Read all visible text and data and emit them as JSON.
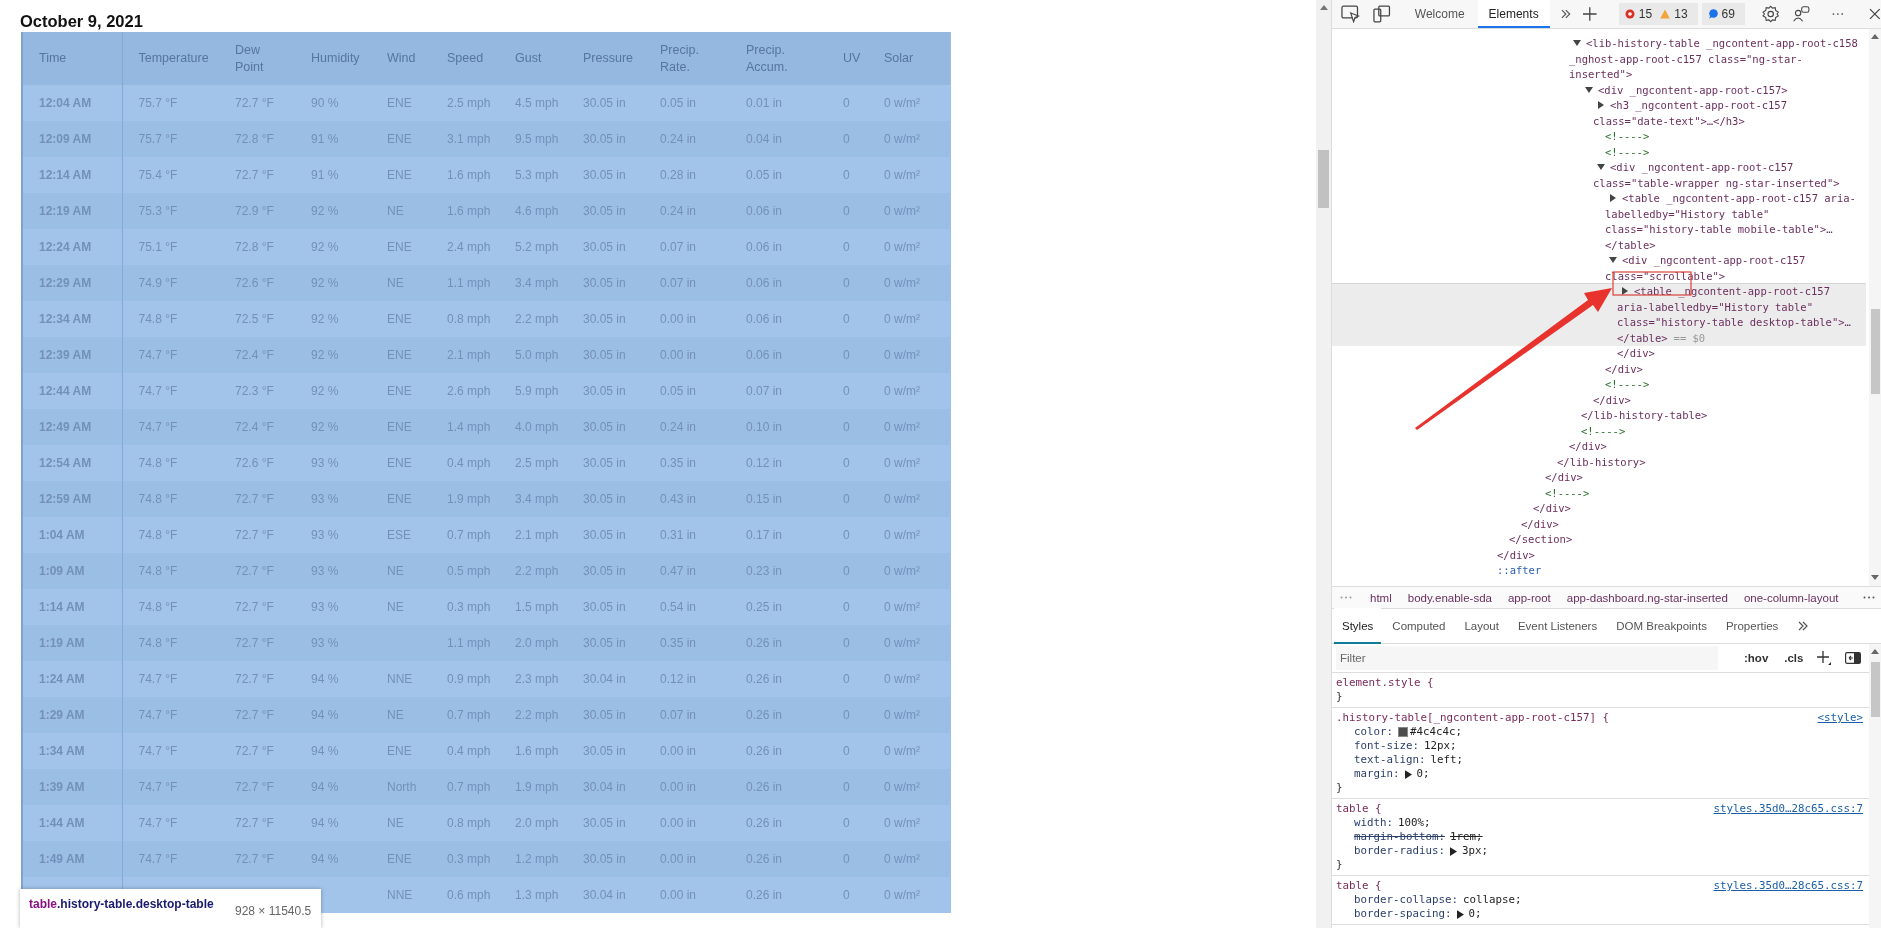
{
  "page": {
    "heading": "October 9, 2021",
    "table": {
      "columns": [
        "Time",
        "Temperature",
        "Dew Point",
        "Humidity",
        "Wind",
        "Speed",
        "Gust",
        "Pressure",
        "Precip. Rate.",
        "Precip. Accum.",
        "UV",
        "Solar"
      ],
      "rows": [
        [
          "12:04 AM",
          "75.7 °F",
          "72.7 °F",
          "90 %",
          "ENE",
          "2.5 mph",
          "4.5 mph",
          "30.05 in",
          "0.05 in",
          "0.01 in",
          "0",
          "0 w/m²"
        ],
        [
          "12:09 AM",
          "75.7 °F",
          "72.8 °F",
          "91 %",
          "ENE",
          "3.1 mph",
          "9.5 mph",
          "30.05 in",
          "0.24 in",
          "0.04 in",
          "0",
          "0 w/m²"
        ],
        [
          "12:14 AM",
          "75.4 °F",
          "72.7 °F",
          "91 %",
          "ENE",
          "1.6 mph",
          "5.3 mph",
          "30.05 in",
          "0.28 in",
          "0.05 in",
          "0",
          "0 w/m²"
        ],
        [
          "12:19 AM",
          "75.3 °F",
          "72.9 °F",
          "92 %",
          "NE",
          "1.6 mph",
          "4.6 mph",
          "30.05 in",
          "0.24 in",
          "0.06 in",
          "0",
          "0 w/m²"
        ],
        [
          "12:24 AM",
          "75.1 °F",
          "72.8 °F",
          "92 %",
          "ENE",
          "2.4 mph",
          "5.2 mph",
          "30.05 in",
          "0.07 in",
          "0.06 in",
          "0",
          "0 w/m²"
        ],
        [
          "12:29 AM",
          "74.9 °F",
          "72.6 °F",
          "92 %",
          "NE",
          "1.1 mph",
          "3.4 mph",
          "30.05 in",
          "0.07 in",
          "0.06 in",
          "0",
          "0 w/m²"
        ],
        [
          "12:34 AM",
          "74.8 °F",
          "72.5 °F",
          "92 %",
          "ENE",
          "0.8 mph",
          "2.2 mph",
          "30.05 in",
          "0.00 in",
          "0.06 in",
          "0",
          "0 w/m²"
        ],
        [
          "12:39 AM",
          "74.7 °F",
          "72.4 °F",
          "92 %",
          "ENE",
          "2.1 mph",
          "5.0 mph",
          "30.05 in",
          "0.00 in",
          "0.06 in",
          "0",
          "0 w/m²"
        ],
        [
          "12:44 AM",
          "74.7 °F",
          "72.3 °F",
          "92 %",
          "ENE",
          "2.6 mph",
          "5.9 mph",
          "30.05 in",
          "0.05 in",
          "0.07 in",
          "0",
          "0 w/m²"
        ],
        [
          "12:49 AM",
          "74.7 °F",
          "72.4 °F",
          "92 %",
          "ENE",
          "1.4 mph",
          "4.0 mph",
          "30.05 in",
          "0.24 in",
          "0.10 in",
          "0",
          "0 w/m²"
        ],
        [
          "12:54 AM",
          "74.8 °F",
          "72.6 °F",
          "93 %",
          "ENE",
          "0.4 mph",
          "2.5 mph",
          "30.05 in",
          "0.35 in",
          "0.12 in",
          "0",
          "0 w/m²"
        ],
        [
          "12:59 AM",
          "74.8 °F",
          "72.7 °F",
          "93 %",
          "ENE",
          "1.9 mph",
          "3.4 mph",
          "30.05 in",
          "0.43 in",
          "0.15 in",
          "0",
          "0 w/m²"
        ],
        [
          "1:04 AM",
          "74.8 °F",
          "72.7 °F",
          "93 %",
          "ESE",
          "0.7 mph",
          "2.1 mph",
          "30.05 in",
          "0.31 in",
          "0.17 in",
          "0",
          "0 w/m²"
        ],
        [
          "1:09 AM",
          "74.8 °F",
          "72.7 °F",
          "93 %",
          "NE",
          "0.5 mph",
          "2.2 mph",
          "30.05 in",
          "0.47 in",
          "0.23 in",
          "0",
          "0 w/m²"
        ],
        [
          "1:14 AM",
          "74.8 °F",
          "72.7 °F",
          "93 %",
          "NE",
          "0.3 mph",
          "1.5 mph",
          "30.05 in",
          "0.54 in",
          "0.25 in",
          "0",
          "0 w/m²"
        ],
        [
          "1:19 AM",
          "74.8 °F",
          "72.7 °F",
          "93 %",
          null,
          "1.1 mph",
          "2.0 mph",
          "30.05 in",
          "0.35 in",
          "0.26 in",
          "0",
          "0 w/m²"
        ],
        [
          "1:24 AM",
          "74.7 °F",
          "72.7 °F",
          "94 %",
          "NNE",
          "0.9 mph",
          "2.3 mph",
          "30.04 in",
          "0.12 in",
          "0.26 in",
          "0",
          "0 w/m²"
        ],
        [
          "1:29 AM",
          "74.7 °F",
          "72.7 °F",
          "94 %",
          "NE",
          "0.7 mph",
          "2.2 mph",
          "30.05 in",
          "0.07 in",
          "0.26 in",
          "0",
          "0 w/m²"
        ],
        [
          "1:34 AM",
          "74.7 °F",
          "72.7 °F",
          "94 %",
          "ENE",
          "0.4 mph",
          "1.6 mph",
          "30.05 in",
          "0.00 in",
          "0.26 in",
          "0",
          "0 w/m²"
        ],
        [
          "1:39 AM",
          "74.7 °F",
          "72.7 °F",
          "94 %",
          "North",
          "0.7 mph",
          "1.9 mph",
          "30.04 in",
          "0.00 in",
          "0.26 in",
          "0",
          "0 w/m²"
        ],
        [
          "1:44 AM",
          "74.7 °F",
          "72.7 °F",
          "94 %",
          "NE",
          "0.8 mph",
          "2.0 mph",
          "30.05 in",
          "0.00 in",
          "0.26 in",
          "0",
          "0 w/m²"
        ],
        [
          "1:49 AM",
          "74.7 °F",
          "72.7 °F",
          "94 %",
          "ENE",
          "0.3 mph",
          "1.2 mph",
          "30.05 in",
          "0.00 in",
          "0.26 in",
          "0",
          "0 w/m²"
        ],
        [
          null,
          null,
          null,
          null,
          "NNE",
          "0.6 mph",
          "1.3 mph",
          "30.04 in",
          "0.00 in",
          "0.26 in",
          "0",
          "0 w/m²"
        ]
      ]
    },
    "tooltip": {
      "tag": "table",
      "classes": ".history-table.desktop-table",
      "size": "928 × 11540.5"
    }
  },
  "devtools": {
    "tabs": [
      {
        "label": "Welcome",
        "selected": false
      },
      {
        "label": "Elements",
        "selected": true
      }
    ],
    "errors": "15",
    "warnings": "13",
    "issues": "69",
    "dom_tree": [
      {
        "kind": "element",
        "close": "</div>",
        "children": [
          {
            "kind": "element",
            "close": "</section>",
            "children": [
              {
                "kind": "element",
                "close": "</div>",
                "children": [
                  {
                    "kind": "element",
                    "close": "</div>",
                    "children": [
                      {
                        "kind": "element",
                        "close": "</div>",
                        "children": [
                          {
                            "kind": "element",
                            "close": "</lib-history>",
                            "children": [
                              {
                                "kind": "element",
                                "close": "</div>",
                                "children": [
                                  {
                                    "kind": "element",
                                    "selected": false,
                                    "expanded": true,
                                    "tag": "<lib-history-table _ngcontent-app-root-c158 _nghost-app-root-c157 class=\"ng-star-inserted\">",
                                    "close": "</lib-history-table>",
                                    "children": [
                                      {
                                        "kind": "element",
                                        "selected": false,
                                        "expanded": true,
                                        "tag": "<div _ngcontent-app-root-c157>",
                                        "close": "</div>",
                                        "children": [
                                          {
                                            "kind": "element",
                                            "selected": false,
                                            "expanded": false,
                                            "tag": "<h3 _ngcontent-app-root-c157 class=\"date-text\">…</h3>"
                                          },
                                          {
                                            "kind": "comment",
                                            "selected": false,
                                            "tag": "<!---->"
                                          },
                                          {
                                            "kind": "comment",
                                            "selected": false,
                                            "tag": "<!---->"
                                          },
                                          {
                                            "kind": "element",
                                            "selected": false,
                                            "expanded": true,
                                            "tag": "<div _ngcontent-app-root-c157 class=\"table-wrapper ng-star-inserted\">",
                                            "close": "</div>",
                                            "children": [
                                              {
                                                "kind": "element",
                                                "selected": false,
                                                "expanded": false,
                                                "tag": "<table _ngcontent-app-root-c157 aria-labelledby=\"History table\" class=\"history-table mobile-table\">…</table>"
                                              },
                                              {
                                                "kind": "element",
                                                "selected": false,
                                                "expanded": true,
                                                "tag": "<div _ngcontent-app-root-c157 class=\"scrollable\">",
                                                "close": "</div>",
                                                "children": [
                                                  {
                                                    "kind": "element",
                                                    "selected": true,
                                                    "expanded": false,
                                                    "tag": "<table _ngcontent-app-root-c157 aria-labelledby=\"History table\" class=\"history-table desktop-table\">…</table>",
                                                    "suffix": "== $0"
                                                  }
                                                ]
                                              }
                                            ]
                                          },
                                          {
                                            "kind": "comment",
                                            "selected": false,
                                            "tag": "<!---->"
                                          }
                                        ]
                                      }
                                    ]
                                  },
                                  {
                                    "kind": "comment",
                                    "selected": false,
                                    "tag": "<!---->"
                                  }
                                ]
                              }
                            ]
                          }
                        ]
                      },
                      {
                        "kind": "comment",
                        "selected": false,
                        "tag": "<!---->"
                      }
                    ]
                  }
                ]
              }
            ]
          }
        ]
      },
      {
        "kind": "pseudo",
        "selected": false,
        "tag": "::after"
      }
    ],
    "breadcrumbs": [
      "html",
      "body.enable-sda",
      "app-root",
      "app-dashboard.ng-star-inserted",
      "one-column-layout"
    ],
    "styles_tabs": [
      {
        "label": "Styles",
        "selected": true
      },
      {
        "label": "Computed",
        "selected": false
      },
      {
        "label": "Layout",
        "selected": false
      },
      {
        "label": "Event Listeners",
        "selected": false
      },
      {
        "label": "DOM Breakpoints",
        "selected": false
      },
      {
        "label": "Properties",
        "selected": false
      }
    ],
    "filter": {
      "placeholder": "Filter"
    },
    "filter_buttons": [
      ":hov",
      ".cls"
    ],
    "rules": [
      {
        "selector": "element.style {",
        "close": "}"
      },
      {
        "selector": ".history-table[_ngcontent-app-root-c157] {",
        "source": "<style>",
        "close": "}",
        "properties": [
          {
            "name": "color:",
            "value": "#4c4c4c;",
            "swatch": true,
            "overridden": false
          },
          {
            "name": "font-size:",
            "value": "12px;",
            "overridden": false
          },
          {
            "name": "text-align:",
            "value": "left;",
            "overridden": false
          },
          {
            "name": "margin:",
            "value": "0;",
            "expandable": true,
            "overridden": false
          }
        ]
      },
      {
        "selector": "table {",
        "source": "styles.35d0…28c65.css:7",
        "close": "}",
        "properties": [
          {
            "name": "width:",
            "value": "100%;",
            "overridden": false
          },
          {
            "name": "margin-bottom:",
            "value": "1rem;",
            "overridden": true
          },
          {
            "name": "border-radius:",
            "value": "3px;",
            "expandable": true,
            "overridden": false
          }
        ]
      },
      {
        "selector": "table {",
        "source": "styles.35d0…28c65.css:7",
        "properties": [
          {
            "name": "border-collapse:",
            "value": "collapse;",
            "overridden": false
          },
          {
            "name": "border-spacing:",
            "value": "0;",
            "expandable": true,
            "overridden": false
          }
        ]
      }
    ]
  }
}
